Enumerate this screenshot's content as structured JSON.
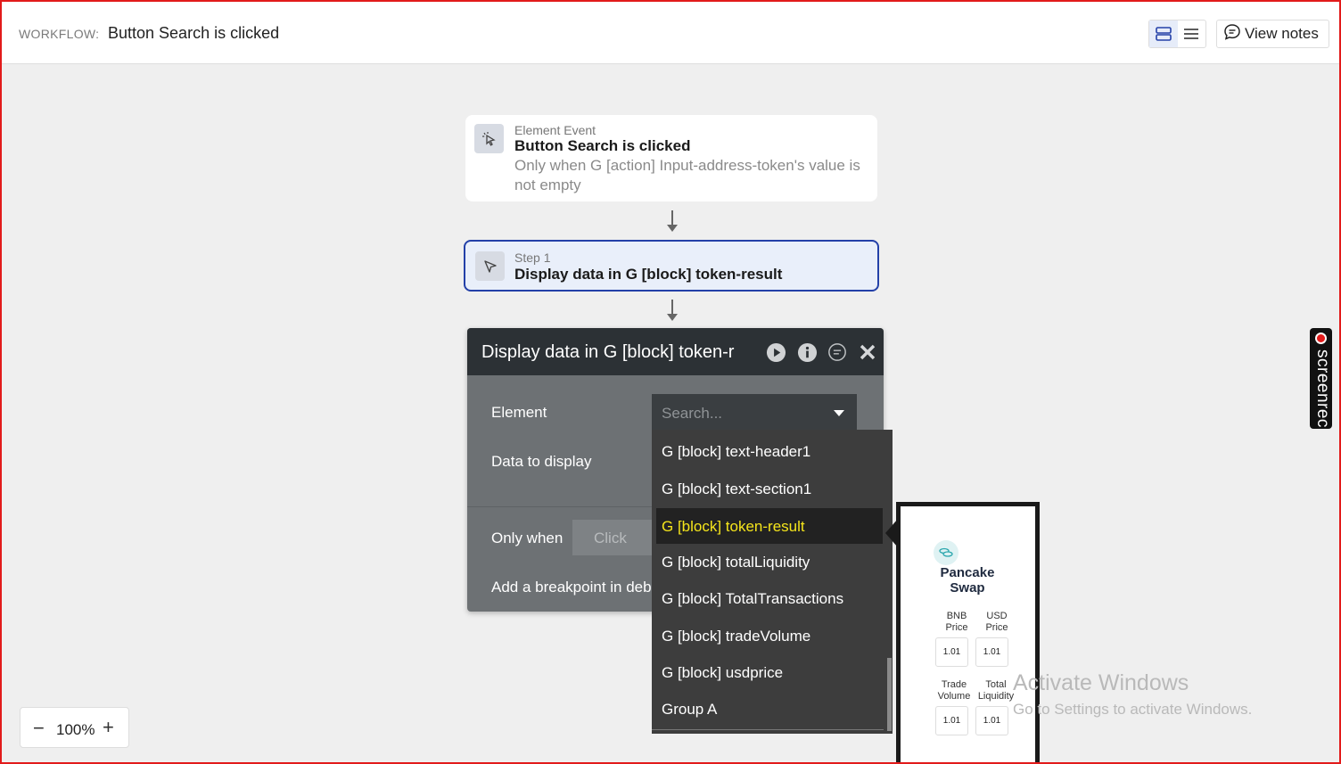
{
  "header": {
    "workflow_label": "WORKFLOW:",
    "workflow_title": "Button Search is clicked",
    "view_notes_label": "View notes"
  },
  "event_card": {
    "kicker": "Element Event",
    "title": "Button Search is clicked",
    "condition": "Only when G [action] Input-address-token's value is not empty"
  },
  "step_card": {
    "kicker": "Step 1",
    "title": "Display data in G [block] token-result"
  },
  "panel": {
    "title": "Display data in G [block] token-r",
    "element_label": "Element",
    "data_label": "Data to display",
    "only_when_label": "Only when",
    "only_when_placeholder": "Click",
    "breakpoint_label": "Add a breakpoint in deb",
    "search_placeholder": "Search..."
  },
  "dropdown": {
    "items": [
      "G [block] text-header1",
      "G [block] text-section1",
      "G [block] token-result",
      "G [block] totalLiquidity",
      "G [block] TotalTransactions",
      "G [block] tradeVolume",
      "G [block] usdprice",
      "Group A"
    ],
    "selected_index": 2
  },
  "preview": {
    "name": "Pancake Swap",
    "bnb_label": "BNB Price",
    "usd_label": "USD Price",
    "bnb_value": "1.01",
    "usd_value": "1.01",
    "trade_label": "Trade Volume",
    "liquidity_label": "Total Liquidity",
    "trade_value": "1.01",
    "liquidity_value": "1.01"
  },
  "screenrec": {
    "label": "screenrec"
  },
  "watermark": {
    "title": "Activate Windows",
    "subtitle": "Go to Settings to activate Windows."
  },
  "zoom": {
    "minus": "−",
    "value": "100%",
    "plus": "+"
  },
  "colors": {
    "accent": "#2340a8",
    "selected_text": "#f5e51b",
    "frame": "#e21b1b"
  }
}
